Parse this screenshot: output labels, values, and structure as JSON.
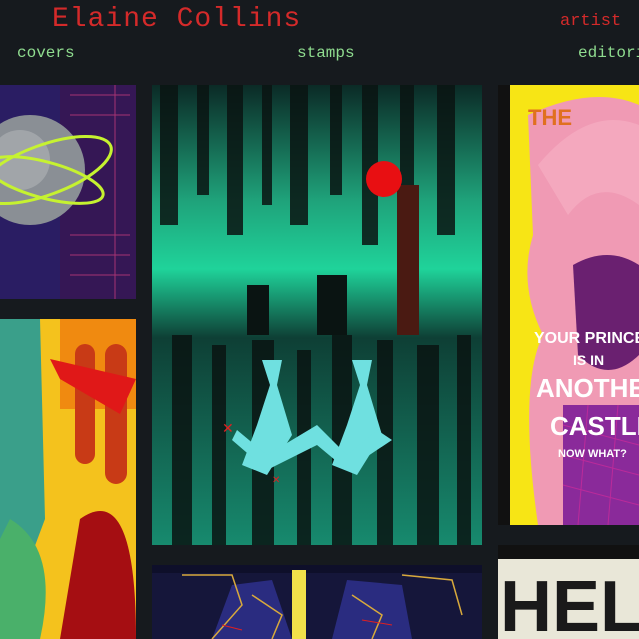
{
  "header": {
    "title": "Elaine Collins",
    "role": "artist",
    "nav": [
      "covers",
      "stamps",
      "editori"
    ]
  },
  "gallery": {
    "tiles": [
      {
        "name": "art-tile-planet-orbit",
        "text": []
      },
      {
        "name": "art-tile-figure-red-scarf",
        "text": []
      },
      {
        "name": "art-tile-twin-rabbits",
        "text": []
      },
      {
        "name": "art-tile-circuit-figure",
        "text": []
      },
      {
        "name": "art-tile-princess-poster",
        "text": [
          "THE",
          "YOUR PRINCESS",
          "IS IN",
          "ANOTHER",
          "CASTLE",
          "NOW WHAT?"
        ]
      },
      {
        "name": "art-tile-hello-poster",
        "text": [
          "HELLO"
        ]
      }
    ]
  }
}
